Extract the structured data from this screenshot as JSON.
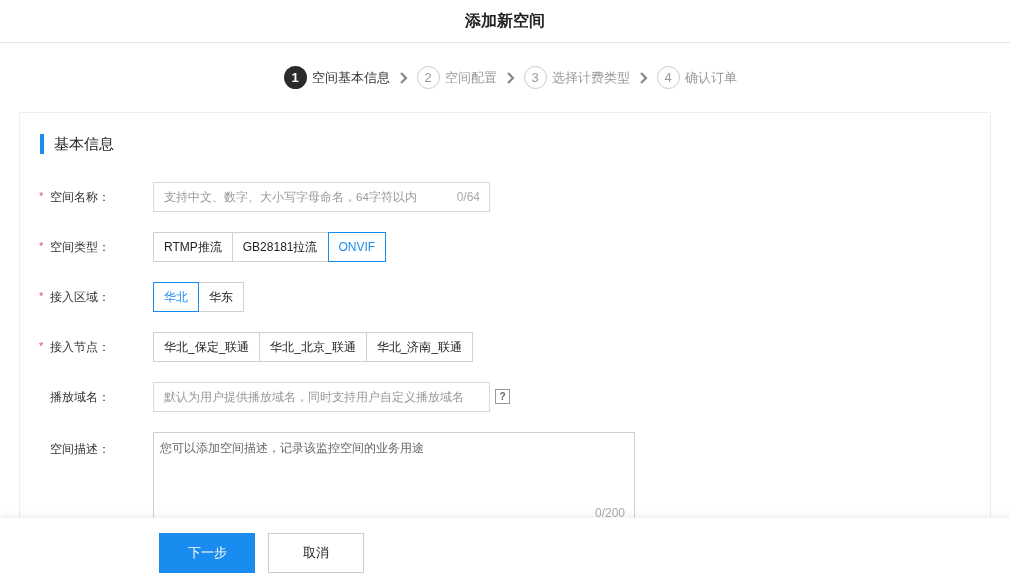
{
  "title": "添加新空间",
  "steps": [
    {
      "number": "1",
      "label": "空间基本信息",
      "selected": true
    },
    {
      "number": "2",
      "label": "空间配置",
      "selected": false
    },
    {
      "number": "3",
      "label": "选择计费类型",
      "selected": false
    },
    {
      "number": "4",
      "label": "确认订单",
      "selected": false
    }
  ],
  "section_title": "基本信息",
  "fields": [
    {
      "kind": "input",
      "required": true,
      "required_mark": "*",
      "label": "空间名称：",
      "placeholder": "支持中文、数字、大小写字母命名，64字符以内",
      "counter": "0/64"
    },
    {
      "kind": "options",
      "required": true,
      "required_mark": "*",
      "label": "空间类型：",
      "options": [
        {
          "label": "RTMP推流",
          "selected": false
        },
        {
          "label": "GB28181拉流",
          "selected": false
        },
        {
          "label": "ONVIF",
          "selected": true
        }
      ]
    },
    {
      "kind": "options",
      "required": true,
      "required_mark": "*",
      "label": "接入区域：",
      "options": [
        {
          "label": "华北",
          "selected": true
        },
        {
          "label": "华东",
          "selected": false
        }
      ]
    },
    {
      "kind": "options",
      "required": true,
      "required_mark": "*",
      "label": "接入节点：",
      "options": [
        {
          "label": "华北_保定_联通",
          "selected": false
        },
        {
          "label": "华北_北京_联通",
          "selected": false
        },
        {
          "label": "华北_济南_联通",
          "selected": false
        }
      ]
    },
    {
      "kind": "input",
      "required": false,
      "label": "播放域名：",
      "placeholder": "默认为用户提供播放域名，同时支持用户自定义播放域名",
      "help": "?"
    },
    {
      "kind": "textarea",
      "required": false,
      "label": "空间描述：",
      "placeholder": "您可以添加空间描述，记录该监控空间的业务用途",
      "counter": "0/200"
    }
  ],
  "buttons": [
    {
      "label": "下一步",
      "kind": "primary"
    },
    {
      "label": "取消",
      "kind": "default"
    }
  ]
}
